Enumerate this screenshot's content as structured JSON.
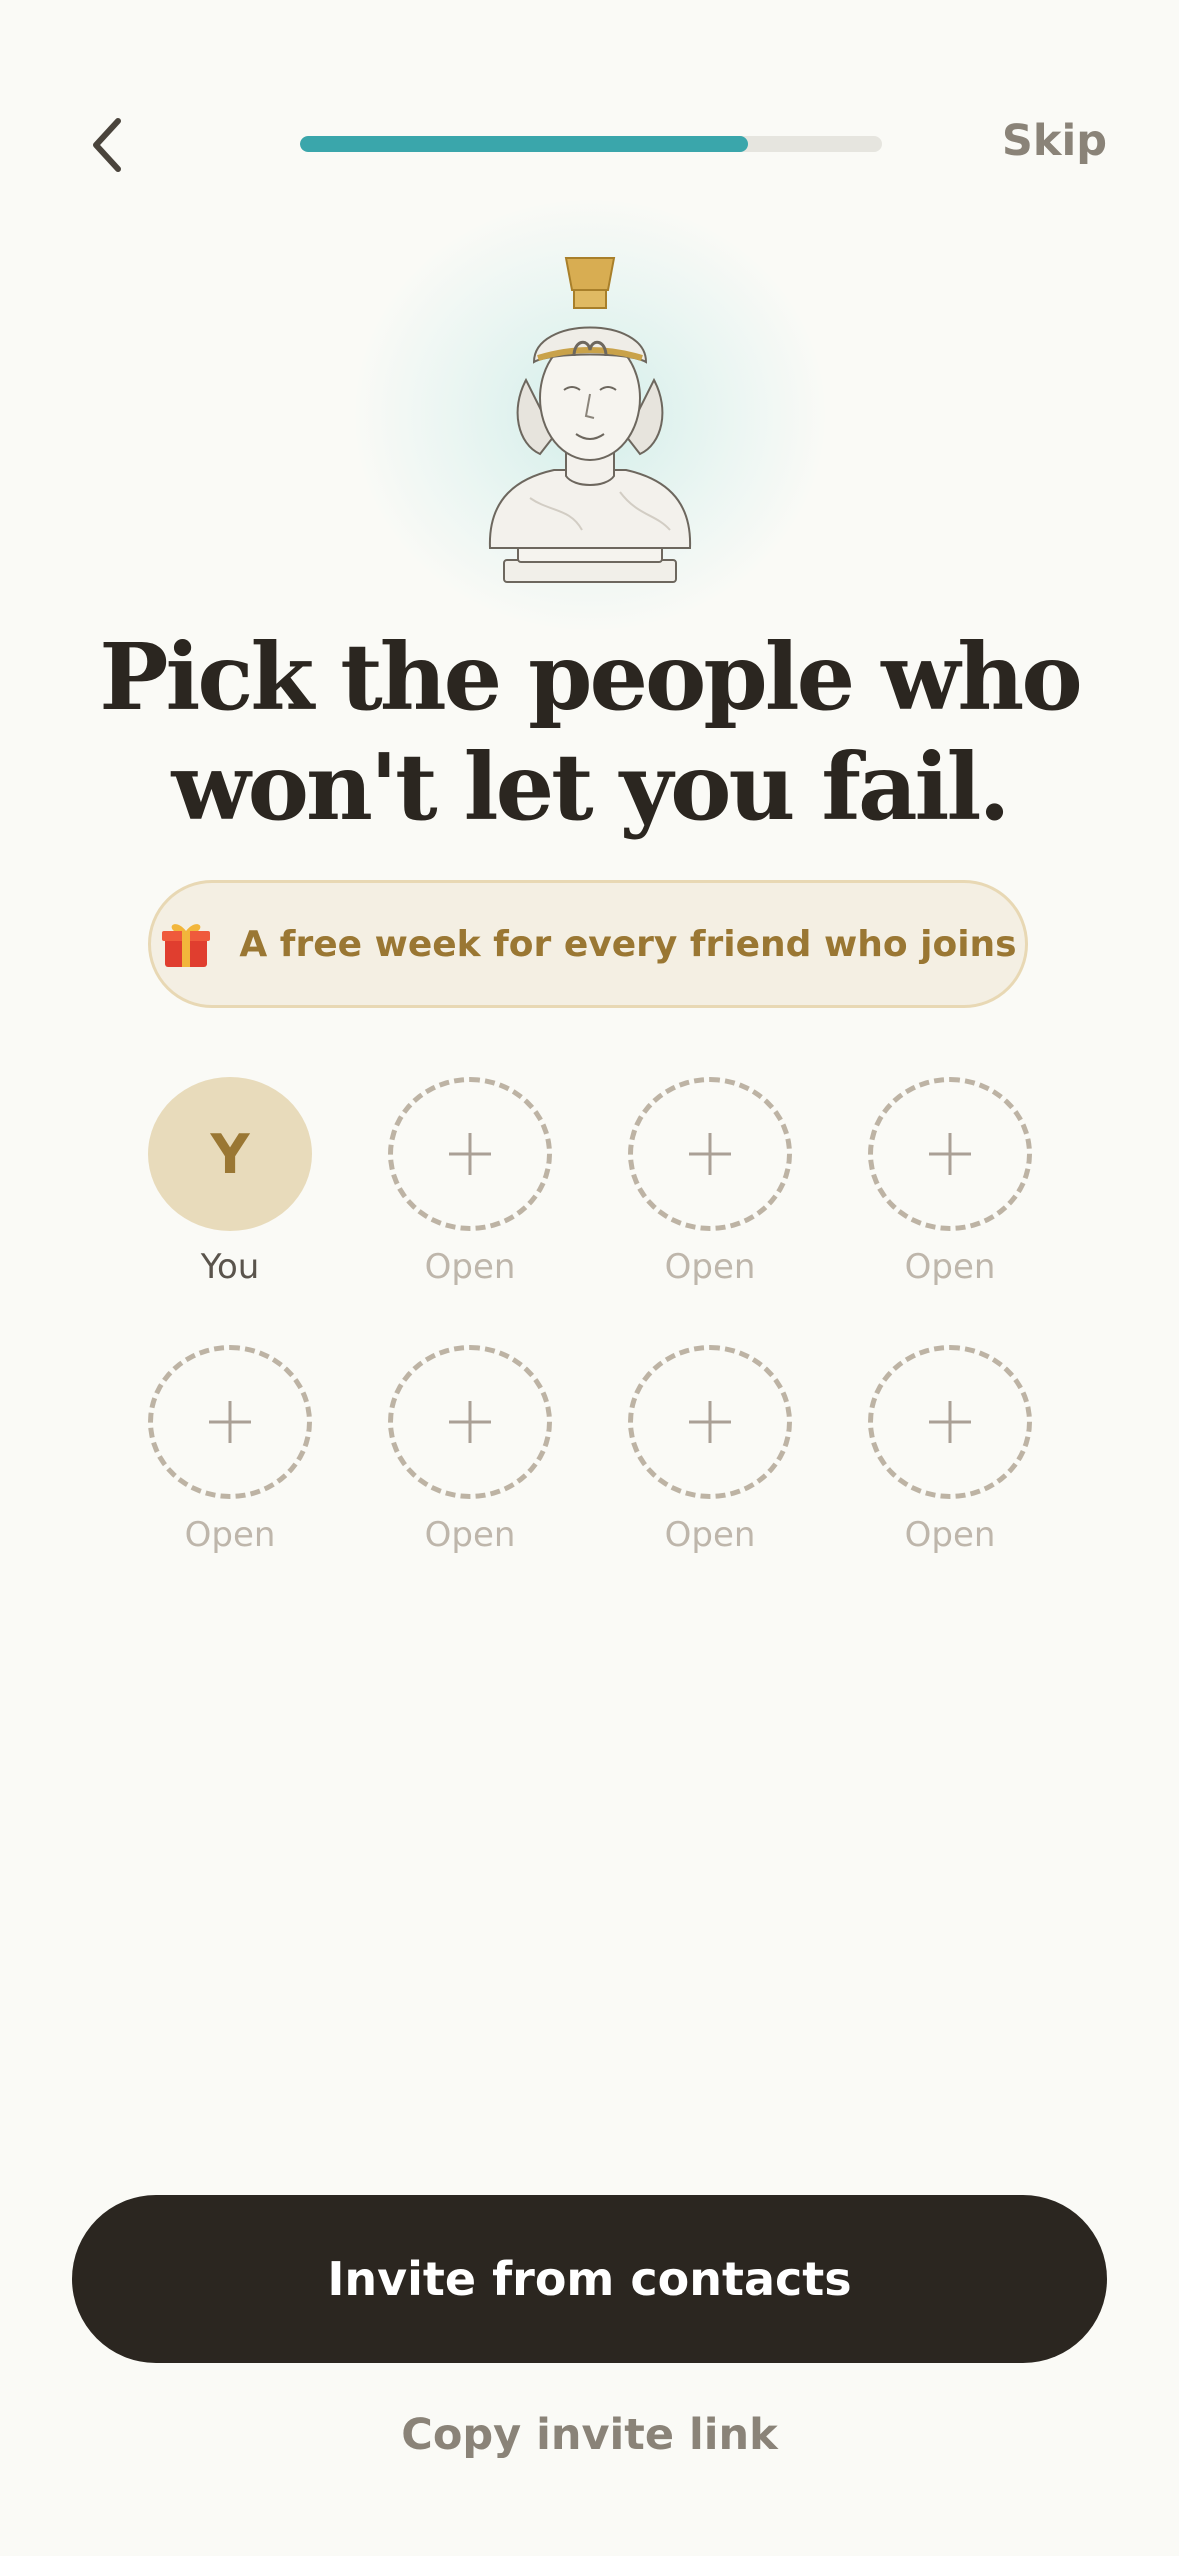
{
  "header": {
    "back_icon": "chevron-left-icon",
    "skip_label": "Skip",
    "progress_fraction": 0.77,
    "progress_color": "#3aa6ab"
  },
  "hero": {
    "icon": "athena-bust-illustration"
  },
  "headline": {
    "line1": "Pick the people who",
    "line2": "won't let you fail."
  },
  "promo": {
    "icon": "gift-icon",
    "text": "A free week for every friend who joins"
  },
  "slots": [
    {
      "label": "You",
      "initial": "Y",
      "type": "you"
    },
    {
      "label": "Open",
      "type": "open"
    },
    {
      "label": "Open",
      "type": "open"
    },
    {
      "label": "Open",
      "type": "open"
    },
    {
      "label": "Open",
      "type": "open"
    },
    {
      "label": "Open",
      "type": "open"
    },
    {
      "label": "Open",
      "type": "open"
    },
    {
      "label": "Open",
      "type": "open"
    }
  ],
  "actions": {
    "primary_label": "Invite from contacts",
    "secondary_label": "Copy invite link"
  },
  "colors": {
    "background": "#fafaf6",
    "accent_gold": "#9a7733",
    "dark_button": "#2b2620"
  }
}
